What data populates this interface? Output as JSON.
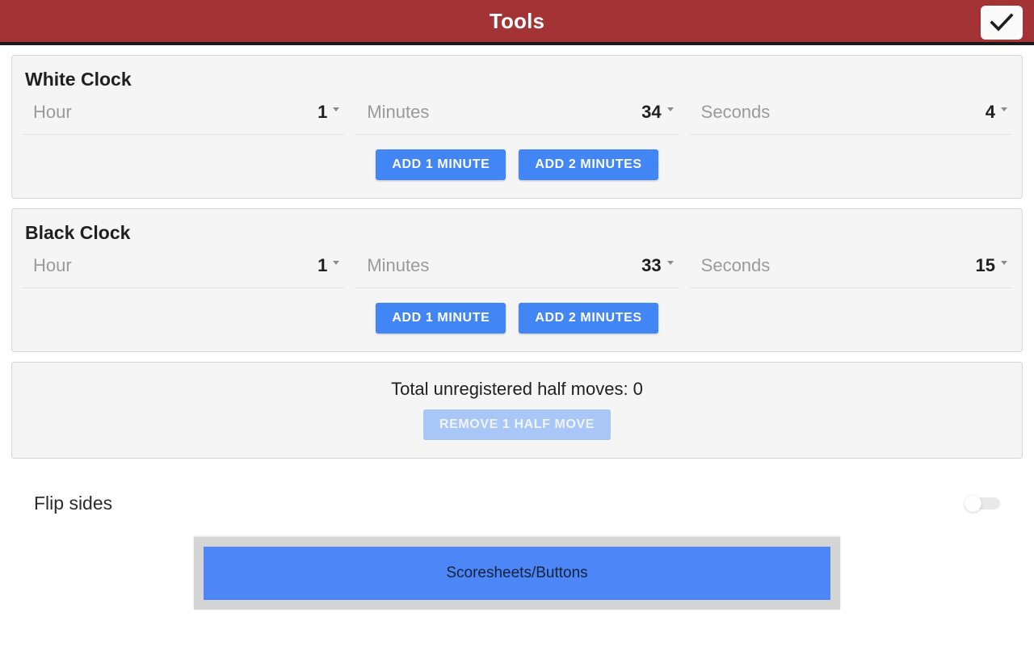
{
  "header": {
    "title": "Tools",
    "confirm_icon": "check-icon"
  },
  "white_clock": {
    "title": "White Clock",
    "fields": [
      {
        "label": "Hour",
        "value": "1"
      },
      {
        "label": "Minutes",
        "value": "34"
      },
      {
        "label": "Seconds",
        "value": "4"
      }
    ],
    "buttons": [
      {
        "label": "ADD 1 MINUTE"
      },
      {
        "label": "ADD 2 MINUTES"
      }
    ]
  },
  "black_clock": {
    "title": "Black Clock",
    "fields": [
      {
        "label": "Hour",
        "value": "1"
      },
      {
        "label": "Minutes",
        "value": "33"
      },
      {
        "label": "Seconds",
        "value": "15"
      }
    ],
    "buttons": [
      {
        "label": "ADD 1 MINUTE"
      },
      {
        "label": "ADD 2 MINUTES"
      }
    ]
  },
  "half_moves": {
    "status_text": "Total unregistered half moves: 0",
    "count": 0,
    "remove_label": "REMOVE 1 HALF MOVE",
    "remove_enabled": false
  },
  "flip_sides": {
    "label": "Flip sides",
    "enabled": false
  },
  "bottom": {
    "label": "Scoresheets/Buttons"
  },
  "colors": {
    "appbar": "#a33334",
    "accent_blue": "#4285f4",
    "disabled_blue": "#a8c7f7",
    "bottom_blue": "#4d87f7",
    "card_bg": "#f5f5f5",
    "panel_gray": "#d5d5d5"
  }
}
